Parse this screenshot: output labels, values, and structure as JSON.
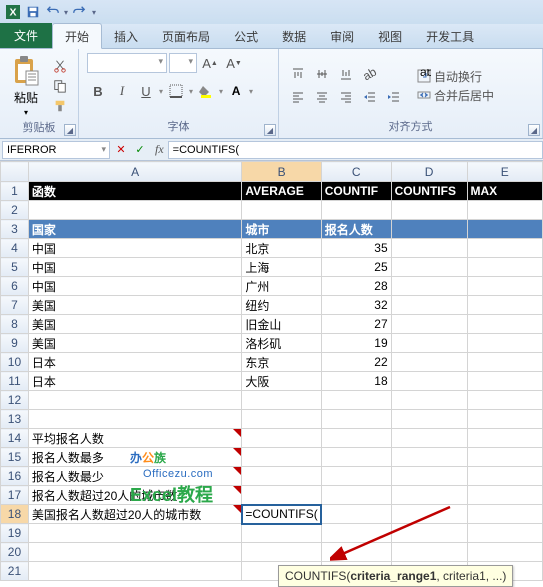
{
  "qat": {
    "save": "save-icon",
    "undo": "undo-icon",
    "redo": "redo-icon",
    "more": "more-icon"
  },
  "tabs": {
    "file": "文件",
    "home": "开始",
    "insert": "插入",
    "layout": "页面布局",
    "formulas": "公式",
    "data": "数据",
    "review": "审阅",
    "view": "视图",
    "dev": "开发工具"
  },
  "ribbon": {
    "clipboard": {
      "label": "剪贴板",
      "paste": "粘贴"
    },
    "font": {
      "label": "字体",
      "bold": "B",
      "italic": "I",
      "underline": "U"
    },
    "align": {
      "label": "对齐方式",
      "wrap": "自动换行",
      "merge": "合并后居中"
    }
  },
  "namebox": "IFERROR",
  "fx": {
    "cancel": "✕",
    "ok": "✓",
    "label": "fx"
  },
  "formula": "=COUNTIFS(",
  "columns": [
    "",
    "A",
    "B",
    "C",
    "D",
    "E"
  ],
  "rows": [
    {
      "n": 1,
      "cls": "hdr-dark",
      "c": [
        "函数",
        "AVERAGE",
        "COUNTIF",
        "COUNTIFS",
        "MAX"
      ]
    },
    {
      "n": 2,
      "c": [
        "",
        "",
        "",
        "",
        ""
      ]
    },
    {
      "n": 3,
      "cls": "hdr-blue",
      "c": [
        "国家",
        "城市",
        "报名人数",
        "",
        ""
      ]
    },
    {
      "n": 4,
      "c": [
        "中国",
        "北京",
        "35",
        "",
        ""
      ]
    },
    {
      "n": 5,
      "c": [
        "中国",
        "上海",
        "25",
        "",
        ""
      ]
    },
    {
      "n": 6,
      "c": [
        "中国",
        "广州",
        "28",
        "",
        ""
      ]
    },
    {
      "n": 7,
      "c": [
        "美国",
        "纽约",
        "32",
        "",
        ""
      ]
    },
    {
      "n": 8,
      "c": [
        "美国",
        "旧金山",
        "27",
        "",
        ""
      ]
    },
    {
      "n": 9,
      "c": [
        "美国",
        "洛杉矶",
        "19",
        "",
        ""
      ]
    },
    {
      "n": 10,
      "c": [
        "日本",
        "东京",
        "22",
        "",
        ""
      ]
    },
    {
      "n": 11,
      "c": [
        "日本",
        "大阪",
        "18",
        "",
        ""
      ]
    },
    {
      "n": 12,
      "c": [
        "",
        "",
        "",
        "",
        ""
      ]
    },
    {
      "n": 13,
      "c": [
        "",
        "",
        "",
        "",
        ""
      ]
    },
    {
      "n": 14,
      "tri": true,
      "c": [
        "平均报名人数",
        "",
        "",
        "",
        ""
      ]
    },
    {
      "n": 15,
      "tri": true,
      "c": [
        "报名人数最多",
        "",
        "",
        "",
        ""
      ]
    },
    {
      "n": 16,
      "tri": true,
      "c": [
        "报名人数最少",
        "",
        "",
        "",
        ""
      ]
    },
    {
      "n": 17,
      "tri": true,
      "c": [
        "报名人数超过20人的城市数",
        "",
        "",
        "",
        ""
      ]
    },
    {
      "n": 18,
      "tri": true,
      "edit": true,
      "c": [
        "美国报名人数超过20人的城市数",
        "=COUNTIFS(",
        "",
        "",
        ""
      ]
    },
    {
      "n": 19,
      "c": [
        "",
        "",
        "",
        "",
        ""
      ]
    },
    {
      "n": 20,
      "c": [
        "",
        "",
        "",
        "",
        ""
      ]
    },
    {
      "n": 21,
      "c": [
        "",
        "",
        "",
        "",
        ""
      ]
    }
  ],
  "tooltip": {
    "fn": "COUNTIFS(",
    "arg1": "criteria_range1",
    "rest": ", criteria1, ...)"
  },
  "watermark": {
    "line1a": "办",
    "line1b": "公",
    "line1c": "族",
    "line2": "Officezu.com",
    "line3": "Excel教程"
  }
}
